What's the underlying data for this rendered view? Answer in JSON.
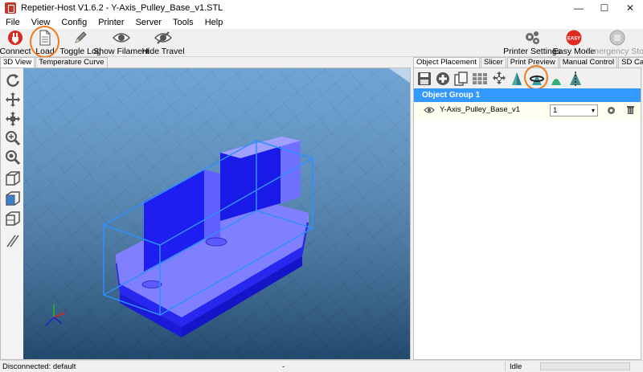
{
  "window": {
    "title": "Repetier-Host V1.6.2 - Y-Axis_Pulley_Base_v1.STL",
    "controls": {
      "minimize": "—",
      "maximize": "☐",
      "close": "✕"
    }
  },
  "menu": [
    "File",
    "View",
    "Config",
    "Printer",
    "Server",
    "Tools",
    "Help"
  ],
  "toolbar": {
    "connect": "Connect",
    "load": "Load",
    "toggle_log": "Toggle Log",
    "show_filament": "Show Filament",
    "hide_travel": "Hide Travel",
    "printer_settings": "Printer Settings",
    "easy_mode": "Easy Mode",
    "easy_badge": "EASY",
    "emergency_stop": "Emergency Stop"
  },
  "left_tabs": [
    "3D View",
    "Temperature Curve"
  ],
  "right_tabs": [
    "Object Placement",
    "Slicer",
    "Print Preview",
    "Manual Control",
    "SD Card"
  ],
  "object_list": {
    "group_name": "Object Group 1",
    "objects": [
      {
        "name": "Y-Axis_Pulley_Base_v1",
        "copies": "1"
      }
    ]
  },
  "status": {
    "connection": "Disconnected: default",
    "center": "-",
    "state": "Idle"
  },
  "colors": {
    "accent": "#3399ff",
    "highlight": "#f07a1e",
    "model": "#2d2dff",
    "bed": "#3f86c6",
    "bbox": "#2f8fff"
  }
}
